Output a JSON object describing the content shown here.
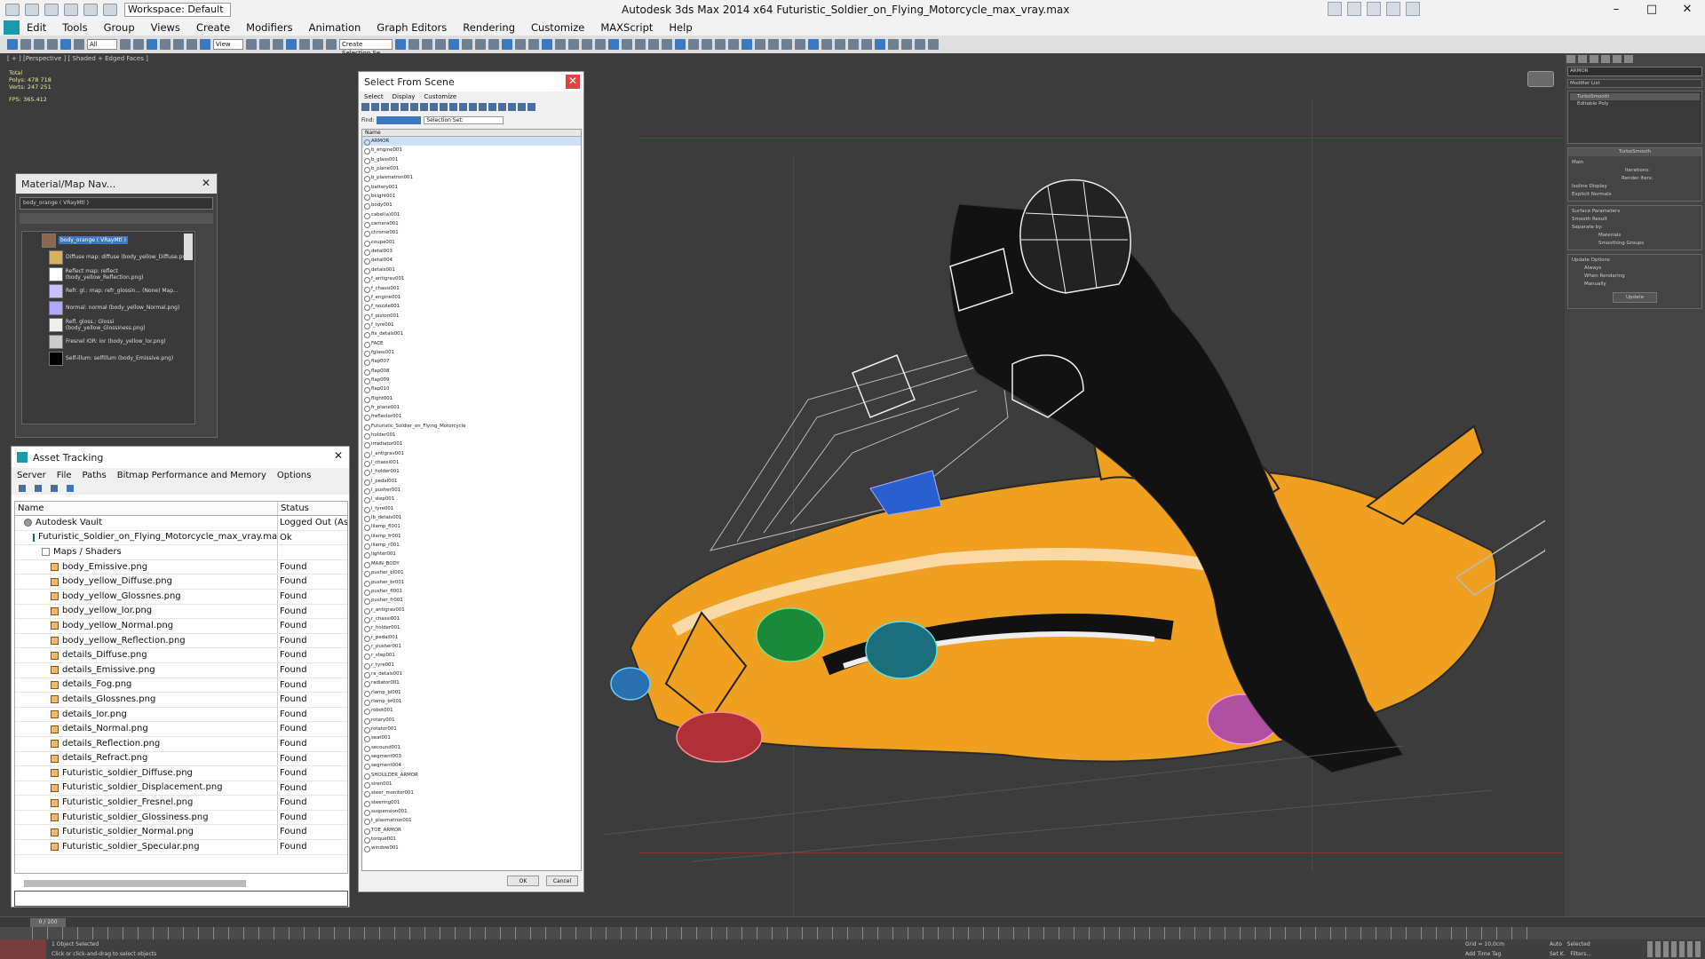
{
  "window": {
    "workspace": "Workspace: Default",
    "title": "Autodesk 3ds Max  2014 x64     Futuristic_Soldier_on_Flying_Motorcycle_max_vray.max"
  },
  "menu": [
    "Edit",
    "Tools",
    "Group",
    "Views",
    "Create",
    "Modifiers",
    "Animation",
    "Graph Editors",
    "Rendering",
    "Customize",
    "MAXScript",
    "Help"
  ],
  "toolbar": {
    "selection_filter": "All",
    "ref_coord": "View",
    "named_sel": "Create Selection Se"
  },
  "viewport": {
    "label": "[ + ] [Perspective ] [ Shaded + Edged Faces ]",
    "stats": {
      "total": "Total",
      "polys_label": "Polys:",
      "polys": "478 718",
      "verts_label": "Verts:",
      "verts": "247 251",
      "fps_label": "FPS:",
      "fps": "365.412"
    }
  },
  "material_navigator": {
    "title": "Material/Map Nav...",
    "field": "body_orange  ( VRayMtl )",
    "nodes": [
      "body_orange  ( VRayMtl )",
      "Diffuse map: diffuse (body_yellow_Diffuse.png)",
      "Reflect map: reflect (body_yellow_Reflection.png)",
      "Refr. gl.: map: refr_glossin... (None) Map...",
      "Normal: normal (body_yellow_Normal.png)",
      "Refl. gloss.: Glossi (body_yellow_Glossiness.png)",
      "Fresnel IOR: ior (body_yellow_lor.png)",
      "Self-illum: selfillum (body_Emissive.png)"
    ]
  },
  "select_from_scene": {
    "title": "Select From Scene",
    "menu": [
      "Select",
      "Display",
      "Customize"
    ],
    "find_label": "Find:",
    "selection_set": "Selection Set:",
    "column": "Name",
    "rows": [
      "ARMOR",
      "b_engine001",
      "b_glass001",
      "b_plane001",
      "b_plasmatron001",
      "battery001",
      "bkight001",
      "body001",
      "cabel(a)001",
      "camera001",
      "chrome001",
      "coupe001",
      "detal003",
      "detal004",
      "detals001",
      "f_antigrav001",
      "f_chassi001",
      "f_engine001",
      "f_nozzle001",
      "f_piston001",
      "f_tyre001",
      "fix_detals001",
      "FACE",
      "fglass001",
      "flap007",
      "flap008",
      "flap009",
      "flap010",
      "flight001",
      "fr_plane001",
      "frefleclor001",
      "Futuristic_Soldier_on_Flying_Motorcycle",
      "holder001",
      "irradiator001",
      "l_antigrav001",
      "l_chassi001",
      "l_holder001",
      "l_pedal001",
      "l_pusher001",
      "l_step001",
      "l_tyre001",
      "lb_detals001",
      "lilamp_fl001",
      "lilamp_fr001",
      "lilamp_r001",
      "lighter001",
      "MAIN_BODY",
      "pusher_bl001",
      "pusher_br001",
      "pusher_fl001",
      "pusher_fr001",
      "r_antigrav001",
      "r_chassi001",
      "r_holder001",
      "r_pedal001",
      "r_pusher001",
      "r_step001",
      "r_tyre001",
      "ra_detals001",
      "radiator001",
      "rlamp_bl001",
      "rlamp_br001",
      "robot001",
      "rotary001",
      "rotator001",
      "seat001",
      "secound001",
      "segment003",
      "segment004",
      "SHOULDER_ARMOR",
      "siren001",
      "steer_monitor001",
      "steering001",
      "suspension001",
      "t_plasmatron001",
      "TOE_ARMOR",
      "torque001",
      "window001"
    ],
    "ok": "OK",
    "cancel": "Cancel"
  },
  "asset_tracking": {
    "title": "Asset Tracking",
    "menu": [
      "Server",
      "File",
      "Paths",
      "Bitmap Performance and Memory",
      "Options"
    ],
    "col_name": "Name",
    "col_status": "Status",
    "rows": [
      {
        "name": "Autodesk Vault",
        "status": "Logged Out (Asse",
        "kind": "vault",
        "indent": 1
      },
      {
        "name": "Futuristic_Soldier_on_Flying_Motorcycle_max_vray.max",
        "status": "Ok",
        "kind": "max",
        "indent": 2
      },
      {
        "name": "Maps / Shaders",
        "status": "",
        "kind": "folder",
        "indent": 3
      },
      {
        "name": "body_Emissive.png",
        "status": "Found",
        "kind": "map",
        "indent": 4
      },
      {
        "name": "body_yellow_Diffuse.png",
        "status": "Found",
        "kind": "map",
        "indent": 4
      },
      {
        "name": "body_yellow_Glossnes.png",
        "status": "Found",
        "kind": "map",
        "indent": 4
      },
      {
        "name": "body_yellow_Ior.png",
        "status": "Found",
        "kind": "map",
        "indent": 4
      },
      {
        "name": "body_yellow_Normal.png",
        "status": "Found",
        "kind": "map",
        "indent": 4
      },
      {
        "name": "body_yellow_Reflection.png",
        "status": "Found",
        "kind": "map",
        "indent": 4
      },
      {
        "name": "details_Diffuse.png",
        "status": "Found",
        "kind": "map",
        "indent": 4
      },
      {
        "name": "details_Emissive.png",
        "status": "Found",
        "kind": "map",
        "indent": 4
      },
      {
        "name": "details_Fog.png",
        "status": "Found",
        "kind": "map",
        "indent": 4
      },
      {
        "name": "details_Glossnes.png",
        "status": "Found",
        "kind": "map",
        "indent": 4
      },
      {
        "name": "details_Ior.png",
        "status": "Found",
        "kind": "map",
        "indent": 4
      },
      {
        "name": "details_Normal.png",
        "status": "Found",
        "kind": "map",
        "indent": 4
      },
      {
        "name": "details_Reflection.png",
        "status": "Found",
        "kind": "map",
        "indent": 4
      },
      {
        "name": "details_Refract.png",
        "status": "Found",
        "kind": "map",
        "indent": 4
      },
      {
        "name": "Futuristic_soldier_Diffuse.png",
        "status": "Found",
        "kind": "map",
        "indent": 4
      },
      {
        "name": "Futuristic_soldier_Displacement.png",
        "status": "Found",
        "kind": "map",
        "indent": 4
      },
      {
        "name": "Futuristic_soldier_Fresnel.png",
        "status": "Found",
        "kind": "map",
        "indent": 4
      },
      {
        "name": "Futuristic_soldier_Glossiness.png",
        "status": "Found",
        "kind": "map",
        "indent": 4
      },
      {
        "name": "Futuristic_soldier_Normal.png",
        "status": "Found",
        "kind": "map",
        "indent": 4
      },
      {
        "name": "Futuristic_soldier_Specular.png",
        "status": "Found",
        "kind": "map",
        "indent": 4
      }
    ]
  },
  "command_panel": {
    "object_name": "ARMOR",
    "modifier_list": "Modifier List",
    "stack": [
      "TurboSmooth",
      "Editable Poly"
    ],
    "turbosmooth": {
      "title": "TurboSmooth",
      "main": "Main",
      "iterations": "Iterations:",
      "render_iters": "Render Iters:",
      "isoline": "Isoline Display",
      "explicit": "Explicit Normals",
      "surface": "Surface Parameters",
      "smooth_result": "Smooth Result",
      "separate": "Separate by:",
      "materials": "Materials",
      "smoothing": "Smoothing Groups",
      "update_opts": "Update Options",
      "always": "Always",
      "when_rendering": "When Rendering",
      "manually": "Manually",
      "update": "Update"
    }
  },
  "timeline": {
    "frame": "0 / 100"
  },
  "status": {
    "selected": "1 Object Selected",
    "hint": "Click or click-and-drag to select objects",
    "grid": "Grid = 10,0cm",
    "add_time_tag": "Add Time Tag",
    "auto": "Auto",
    "set_key": "Set K.",
    "selected_dd": "Selected",
    "filters": "Filters..."
  },
  "colors": {
    "accent": "#3a78c2",
    "bike_orange": "#f0a020",
    "background": "#3c3c3c"
  }
}
